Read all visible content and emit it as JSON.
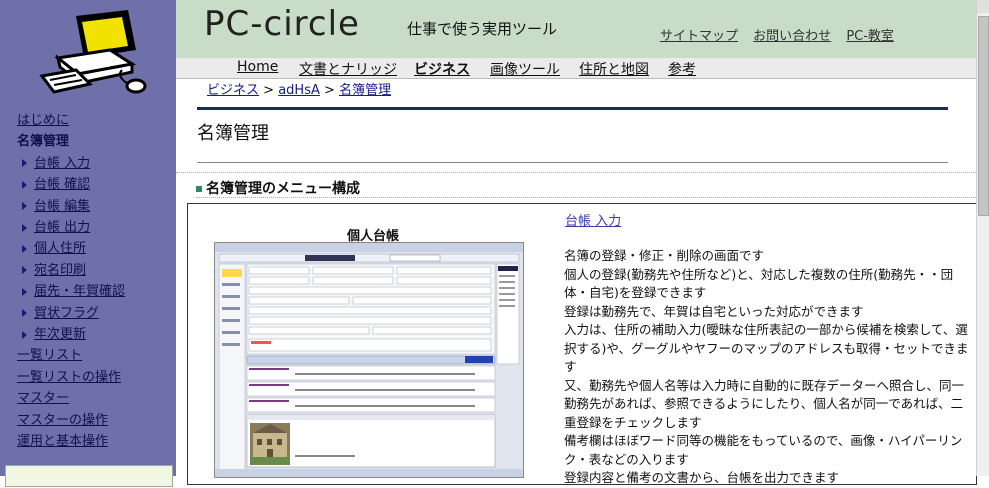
{
  "header": {
    "site_title": "PC-circle",
    "tagline": "仕事で使う実用ツール",
    "utility_links": [
      "サイトマップ",
      "お問い合わせ",
      "PC-教室"
    ]
  },
  "topnav": {
    "items": [
      "Home",
      "文書とナリッジ",
      "ビジネス",
      "画像ツール",
      "住所と地図",
      "参考"
    ],
    "active": "ビジネス"
  },
  "breadcrumb": {
    "parts": [
      "ビジネス",
      "adHsA",
      "名簿管理"
    ],
    "separator": ">"
  },
  "sidebar": {
    "items": [
      {
        "label": "はじめに"
      },
      {
        "label": "名簿管理"
      },
      {
        "label": "台帳 入力"
      },
      {
        "label": "台帳 確認"
      },
      {
        "label": "台帳 編集"
      },
      {
        "label": "台帳 出力"
      },
      {
        "label": "個人住所"
      },
      {
        "label": "宛名印刷"
      },
      {
        "label": "届先・年賀確認"
      },
      {
        "label": "賀状フラグ"
      },
      {
        "label": "年次更新"
      },
      {
        "label": "一覧リスト"
      },
      {
        "label": "一覧リストの操作"
      },
      {
        "label": "マスター"
      },
      {
        "label": "マスターの操作"
      },
      {
        "label": "運用と基本操作"
      }
    ]
  },
  "main": {
    "page_title": "名簿管理",
    "section_heading": "名簿管理のメニュー構成",
    "screenshot_title": "個人台帳",
    "menu_link": "台帳 入力",
    "description": [
      "名簿の登録・修正・削除の画面です",
      "個人の登録(勤務先や住所など)と、対応した複数の住所(勤務先・・団体・自宅)を登録できます",
      "登録は勤務先で、年賀は自宅といった対応ができます",
      "入力は、住所の補助入力(曖昧な住所表記の一部から候補を検索して、選択する)や、グーグルやヤフーのマップのアドレスも取得・セットできます",
      "又、勤務先や個人名等は入力時に自動的に既存データーへ照合し、同一勤務先があれば、参照できるようにしたり、個人名が同一であれば、二重登録をチェックします",
      "備考欄はほぼワード同等の機能をもっているので、画像・ハイパーリンク・表などの入ります",
      "登録内容と備考の文書から、台帳を出力できます"
    ]
  },
  "colors": {
    "sidebar_bg": "#6f6faa",
    "header_bg": "#c8dcc8",
    "link": "#1a1a8c"
  }
}
